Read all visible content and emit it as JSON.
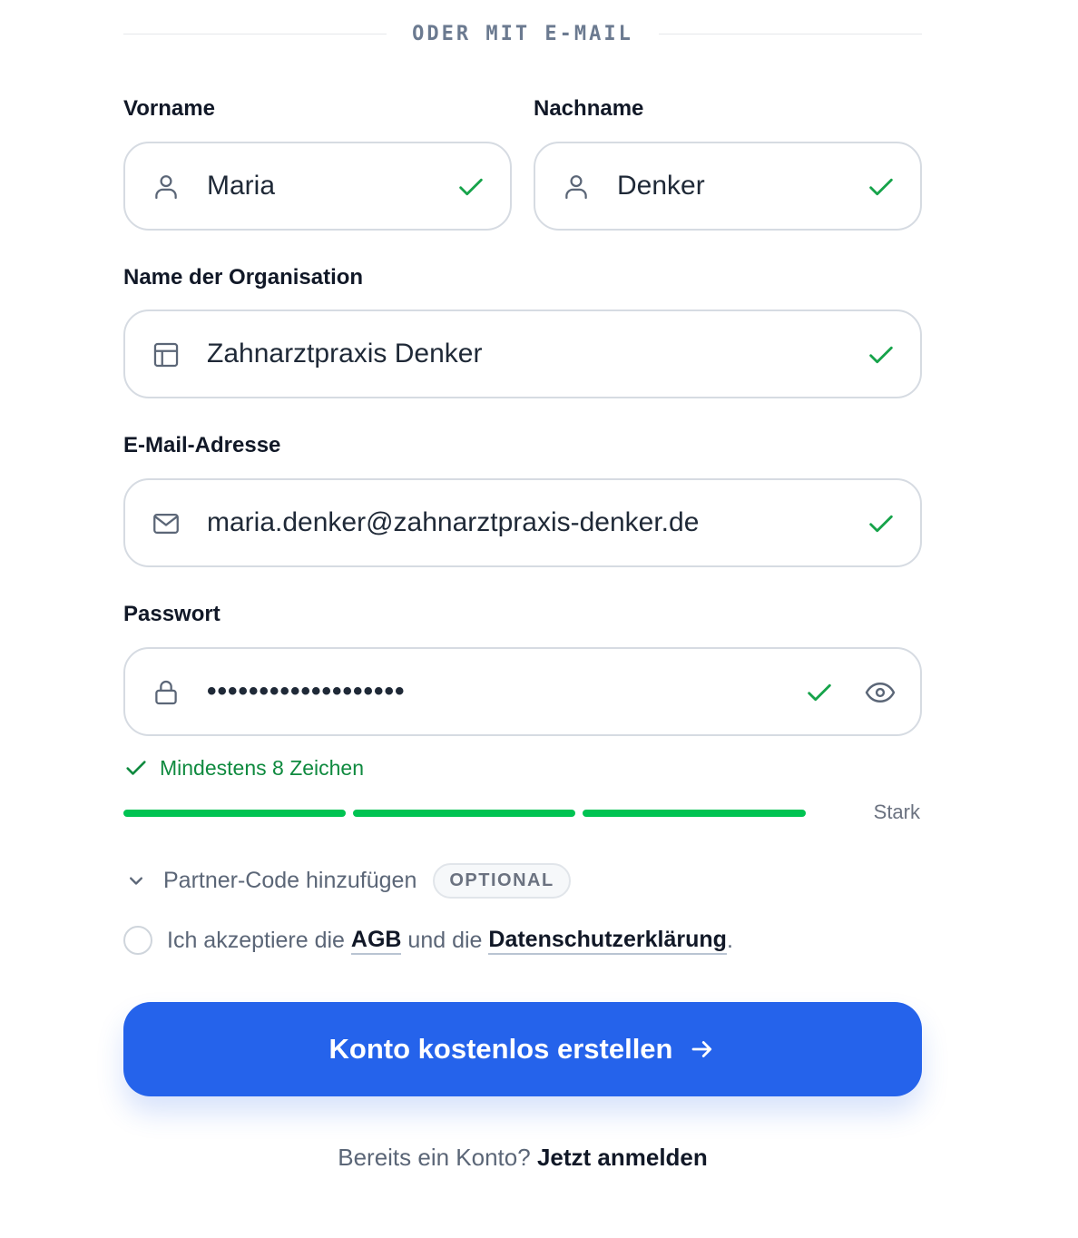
{
  "divider": {
    "text": "ODER MIT E-MAIL"
  },
  "first_name": {
    "label": "Vorname",
    "value": "Maria",
    "icon": "user-icon",
    "valid": true
  },
  "last_name": {
    "label": "Nachname",
    "value": "Denker",
    "icon": "user-icon",
    "valid": true
  },
  "organization": {
    "label": "Name der Organisation",
    "value": "Zahnarztpraxis Denker",
    "icon": "building-icon",
    "valid": true
  },
  "email": {
    "label": "E-Mail-Adresse",
    "value": "maria.denker@zahnarztpraxis-denker.de",
    "icon": "mail-icon",
    "valid": true
  },
  "password": {
    "label": "Passwort",
    "masked_value": "•••••••••••••••••••",
    "icon": "lock-icon",
    "valid": true,
    "toggle_icon": "eye-icon"
  },
  "password_hint": {
    "text": "Mindestens 8 Zeichen",
    "met": true
  },
  "strength": {
    "label": "Stark",
    "filled_segments": 3,
    "total_segments": 3,
    "color": "#00c352"
  },
  "partner_code": {
    "label": "Partner-Code hinzufügen",
    "badge": "OPTIONAL",
    "expanded": false
  },
  "terms": {
    "prefix": "Ich akzeptiere die ",
    "agb": "AGB",
    "middle": " und die ",
    "privacy": "Datenschutzerklärung",
    "suffix": ".",
    "checked": false
  },
  "cta": {
    "label": "Konto kostenlos erstellen",
    "color": "#2563eb"
  },
  "footer": {
    "question": "Bereits ein Konto? ",
    "link": "Jetzt anmelden"
  },
  "colors": {
    "accent": "#2563eb",
    "success": "#16a34a",
    "border": "#d6dbe2"
  }
}
